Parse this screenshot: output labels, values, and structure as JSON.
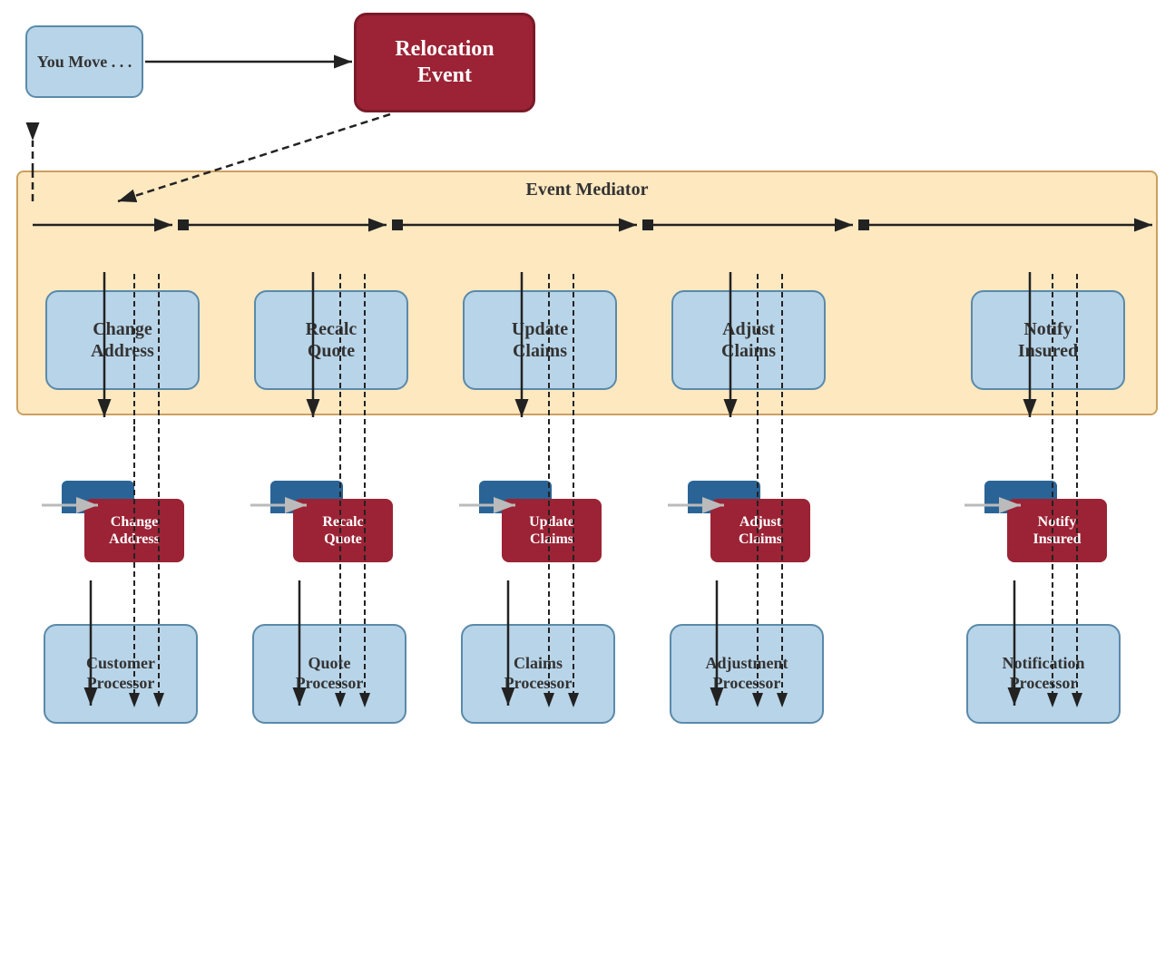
{
  "youMove": {
    "label": "You Move . . ."
  },
  "relocationEvent": {
    "label": "Relocation\nEvent"
  },
  "eventMediator": {
    "label": "Event Mediator"
  },
  "mediatorBoxes": [
    {
      "id": "change-address-med",
      "label": "Change\nAddress"
    },
    {
      "id": "recalc-quote-med",
      "label": "Recalc\nQuote"
    },
    {
      "id": "update-claims-med",
      "label": "Update\nClaims"
    },
    {
      "id": "adjust-claims-med",
      "label": "Adjust\nClaims"
    },
    {
      "id": "notify-insured-med",
      "label": "Notify\nInsured"
    }
  ],
  "serviceGroups": [
    {
      "id": "change-address-svc",
      "msgLabel": "Change\nAddress",
      "processorLabel": "Customer\nProcessor"
    },
    {
      "id": "recalc-quote-svc",
      "msgLabel": "Recalc\nQuote",
      "processorLabel": "Quote\nProcessor"
    },
    {
      "id": "update-claims-svc",
      "msgLabel": "Update\nClaims",
      "processorLabel": "Claims\nProcessor"
    },
    {
      "id": "adjust-claims-svc",
      "msgLabel": "Adjust\nClaims",
      "processorLabel": "Adjustment\nProcessor"
    },
    {
      "id": "notify-insured-svc",
      "msgLabel": "Notify\nInsured",
      "processorLabel": "Notification\nProcessor"
    }
  ],
  "colors": {
    "lightBlue": "#b8d4e8",
    "darkRed": "#9b2335",
    "mediatorBg": "#fde8c0",
    "darkBlue": "#2a6496"
  }
}
